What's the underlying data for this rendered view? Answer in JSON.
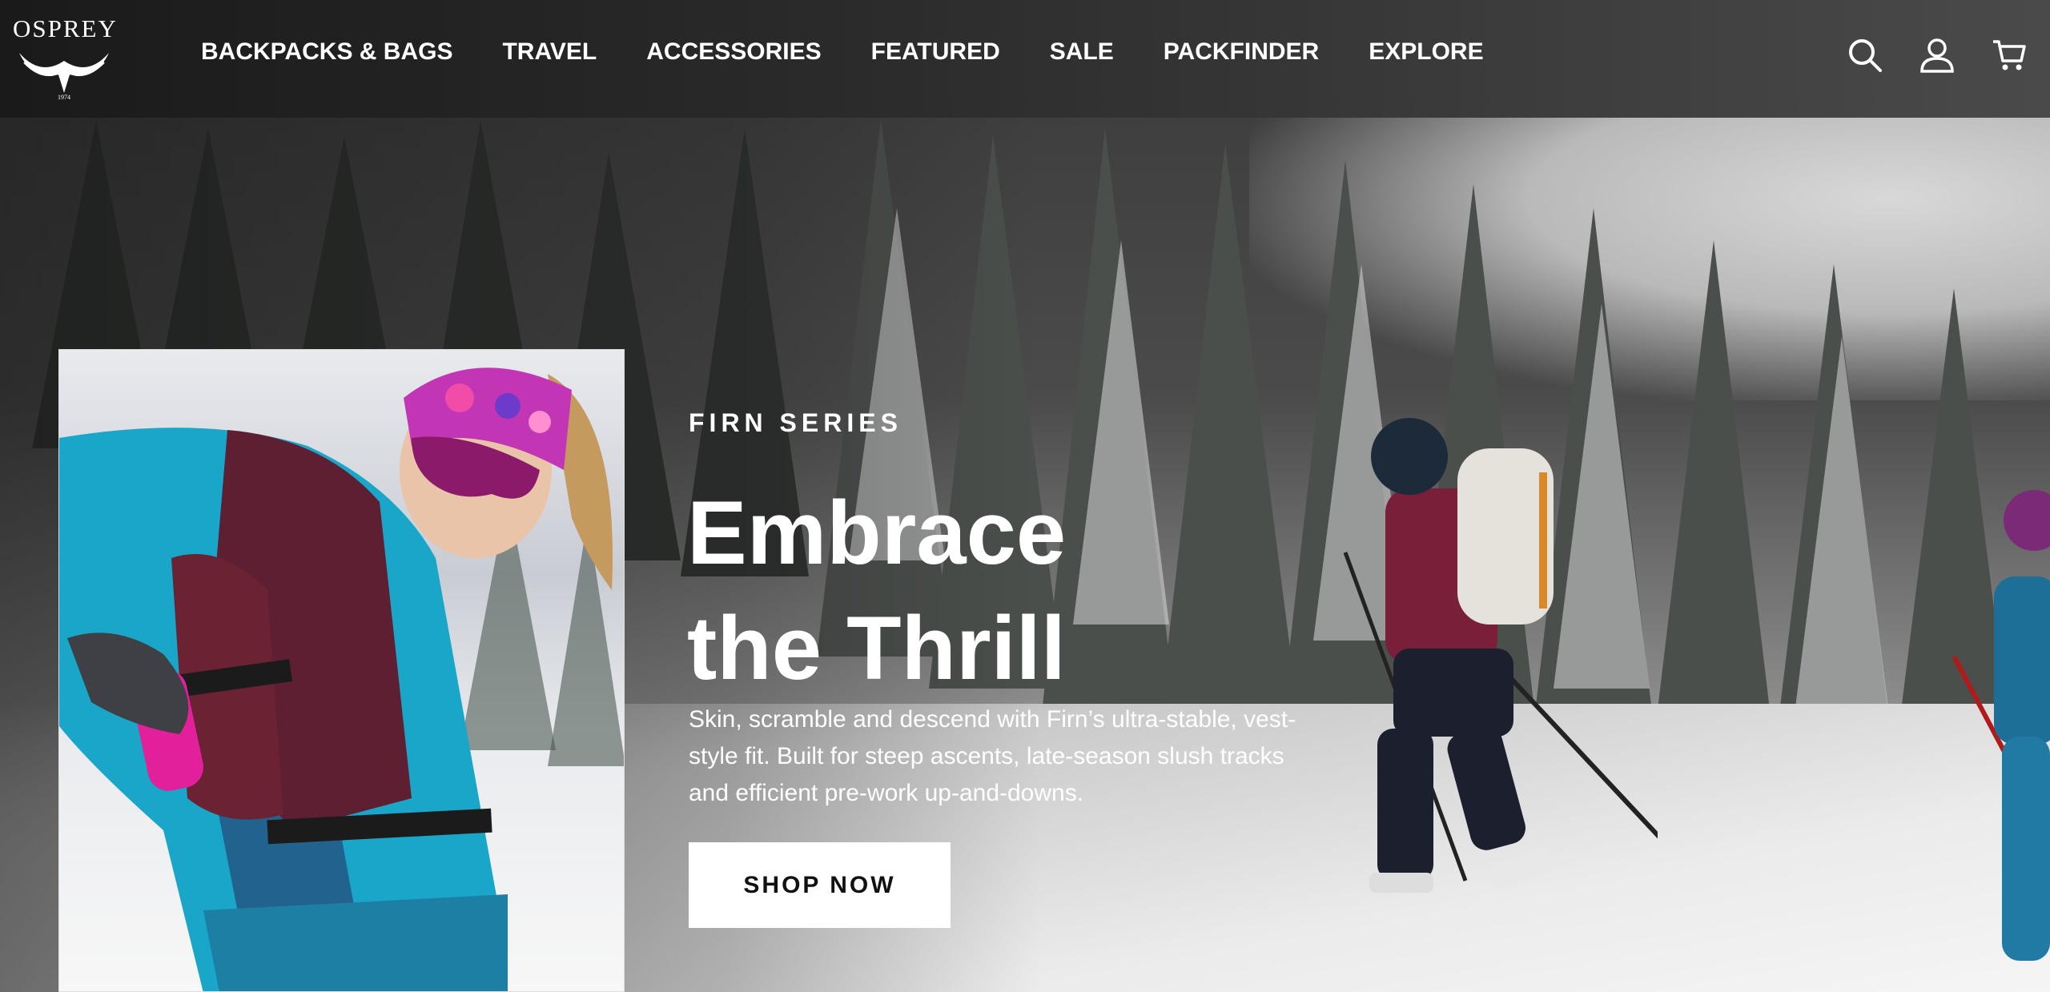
{
  "brand": {
    "logo_text": "OSPREY",
    "logo_icon": "osprey-bird-logo"
  },
  "nav": {
    "items": [
      {
        "label": "BACKPACKS & BAGS"
      },
      {
        "label": "TRAVEL"
      },
      {
        "label": "ACCESSORIES"
      },
      {
        "label": "FEATURED"
      },
      {
        "label": "SALE"
      },
      {
        "label": "PACKFINDER"
      },
      {
        "label": "EXPLORE"
      }
    ]
  },
  "header_icons": [
    "search-icon",
    "account-icon",
    "cart-icon"
  ],
  "hero": {
    "eyebrow": "FIRN SERIES",
    "headline_line1": "Embrace",
    "headline_line2": "the Thrill",
    "description": "Skin, scramble and descend with Firn’s ultra-stable, vest-style fit. Built for steep ascents, late-season slush tracks and efficient pre-work up-and-downs.",
    "cta_label": "SHOP NOW"
  },
  "colors": {
    "header_bg": "#1a1a1a",
    "cta_bg": "#ffffff",
    "cta_text": "#111111",
    "text": "#ffffff"
  }
}
